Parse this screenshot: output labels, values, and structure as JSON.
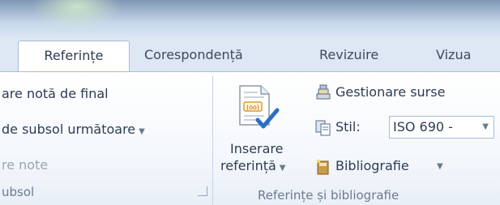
{
  "tabs": [
    {
      "label": "Referințe"
    },
    {
      "label": "Corespondență"
    },
    {
      "label": "Revizuire"
    },
    {
      "label": "Vizua"
    }
  ],
  "footnotes": {
    "insert_endnote": "are notă de final",
    "next_footnote": "de subsol următoare",
    "show_notes": "re note",
    "group_label": "ubsol"
  },
  "citations": {
    "insert_citation_line1": "Inserare",
    "insert_citation_line2": "referință",
    "manage_sources": "Gestionare surse",
    "style_label": "Stil:",
    "style_value": "ISO 690 -",
    "bibliography": "Bibliografie",
    "group_label": "Referințe și bibliografie"
  },
  "icons": {
    "insert_citation": "document-with-checkmark-icon",
    "manage_sources": "stacked-books-icon",
    "style": "style-pages-icon",
    "bibliography": "bibliography-book-icon"
  },
  "colors": {
    "titlebar": "#7f97b5",
    "tabstrip": "#dfe9f5",
    "border": "#a9bcd6",
    "group_label": "#6a7b91",
    "text": "#2d3c52"
  }
}
